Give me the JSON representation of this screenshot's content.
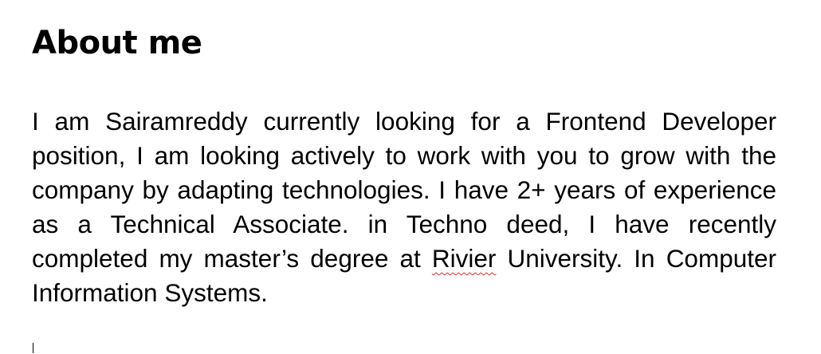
{
  "document": {
    "heading": "About me",
    "paragraph": {
      "before_flagged": "I am Sairamreddy currently looking for a Frontend Developer position, I am looking actively to work with you to grow with the company by adapting technologies. I have 2+ years of experience as a Technical Associate. in Techno deed, I have recently completed my master’s degree at ",
      "flagged_word": "Rivier",
      "after_flagged": " University. In Computer Information Systems."
    }
  },
  "colors": {
    "text": "#000000",
    "background": "#ffffff",
    "spellcheck_underline": "#e0302a"
  }
}
